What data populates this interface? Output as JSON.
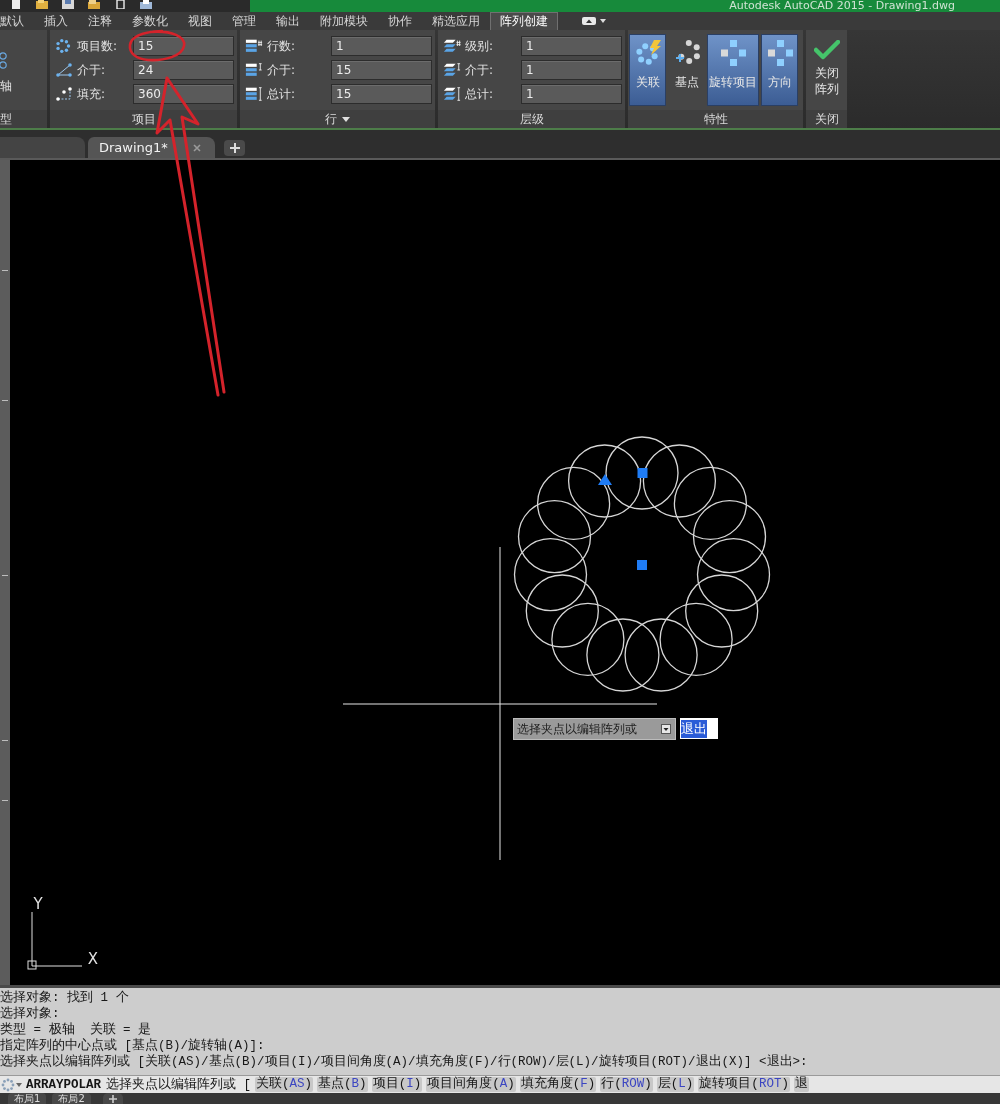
{
  "title_bar": {
    "title": "Autodesk AutoCAD 2015 - Drawing1.dwg"
  },
  "ribbon_tabs": [
    {
      "label": "默认",
      "selected": false
    },
    {
      "label": "插入",
      "selected": false
    },
    {
      "label": "注释",
      "selected": false
    },
    {
      "label": "参数化",
      "selected": false
    },
    {
      "label": "视图",
      "selected": false
    },
    {
      "label": "管理",
      "selected": false
    },
    {
      "label": "输出",
      "selected": false
    },
    {
      "label": "附加模块",
      "selected": false
    },
    {
      "label": "协作",
      "selected": false
    },
    {
      "label": "精选应用",
      "selected": false
    },
    {
      "label": "阵列创建",
      "selected": true
    }
  ],
  "ribbon_panels": [
    {
      "kind": "partial",
      "title": "型",
      "has_menu": false,
      "button": {
        "label": "轴"
      }
    },
    {
      "kind": "items",
      "title": "项目",
      "has_menu": false,
      "rows": [
        {
          "kind": "count",
          "label": "项目数:",
          "value": "15"
        },
        {
          "kind": "spacing",
          "label": "介于:",
          "value": "24"
        },
        {
          "kind": "fill",
          "label": "填充:",
          "value": "360"
        }
      ]
    },
    {
      "kind": "rows",
      "title": "行",
      "has_menu": true,
      "rows": [
        {
          "kind": "count",
          "label": "行数:",
          "value": "1"
        },
        {
          "kind": "spacing",
          "label": "介于:",
          "value": "15"
        },
        {
          "kind": "total",
          "label": "总计:",
          "value": "15"
        }
      ]
    },
    {
      "kind": "levels",
      "title": "层级",
      "has_menu": false,
      "rows": [
        {
          "kind": "count",
          "label": "级别:",
          "value": "1"
        },
        {
          "kind": "spacing",
          "label": "介于:",
          "value": "1"
        },
        {
          "kind": "total",
          "label": "总计:",
          "value": "1"
        }
      ]
    },
    {
      "kind": "properties",
      "title": "特性",
      "has_menu": false,
      "buttons": [
        {
          "kind": "associative",
          "label": "关联",
          "selected": true
        },
        {
          "kind": "base_point",
          "label": "基点",
          "selected": false
        },
        {
          "kind": "rotate_items",
          "label": "旋转项目",
          "selected": true
        },
        {
          "kind": "direction",
          "label": "方向",
          "selected": true
        }
      ]
    },
    {
      "kind": "close",
      "title": "关闭",
      "has_menu": false,
      "buttons": [
        {
          "kind": "close",
          "label": "关闭阵列"
        }
      ]
    }
  ],
  "file_tabs": [
    {
      "selected": false,
      "closable": false
    },
    {
      "label": "Drawing1*",
      "selected": true,
      "closable": true
    }
  ],
  "drawing": {
    "dynamic_input": {
      "prompt": "选择夹点以编辑阵列或",
      "value": "退出",
      "text_selected": true
    },
    "ucs_icon": {
      "x_label": "X",
      "y_label": "Y"
    }
  },
  "command_history": [
    "选择对象: 找到 1 个",
    "选择对象:",
    "类型 = 极轴  关联 = 是",
    "指定阵列的中心点或 [基点(B)/旋转轴(A)]:",
    "选择夹点以编辑阵列或 [关联(AS)/基点(B)/项目(I)/项目间角度(A)/填充角度(F)/行(ROW)/层(L)/旋转项目(ROT)/退出(X)] <退出>:"
  ],
  "command_line": {
    "command": "ARRAYPOLAR",
    "prompt": "选择夹点以编辑阵列或 [",
    "options": [
      {
        "before": "关联(",
        "key": "AS",
        "after": ")"
      },
      {
        "before": "基点(",
        "key": "B",
        "after": ")"
      },
      {
        "before": "项目(",
        "key": "I",
        "after": ")"
      },
      {
        "before": "项目间角度(",
        "key": "A",
        "after": ")"
      },
      {
        "before": "填充角度(",
        "key": "F",
        "after": ")"
      },
      {
        "before": "行(",
        "key": "ROW",
        "after": ")"
      },
      {
        "before": "层(",
        "key": "L",
        "after": ")"
      },
      {
        "before": "旋转项目(",
        "key": "ROT",
        "after": ")"
      },
      {
        "before": "退"
      }
    ]
  },
  "layout_tabs": [
    {
      "label": "布局1"
    },
    {
      "label": "布局2"
    }
  ]
}
